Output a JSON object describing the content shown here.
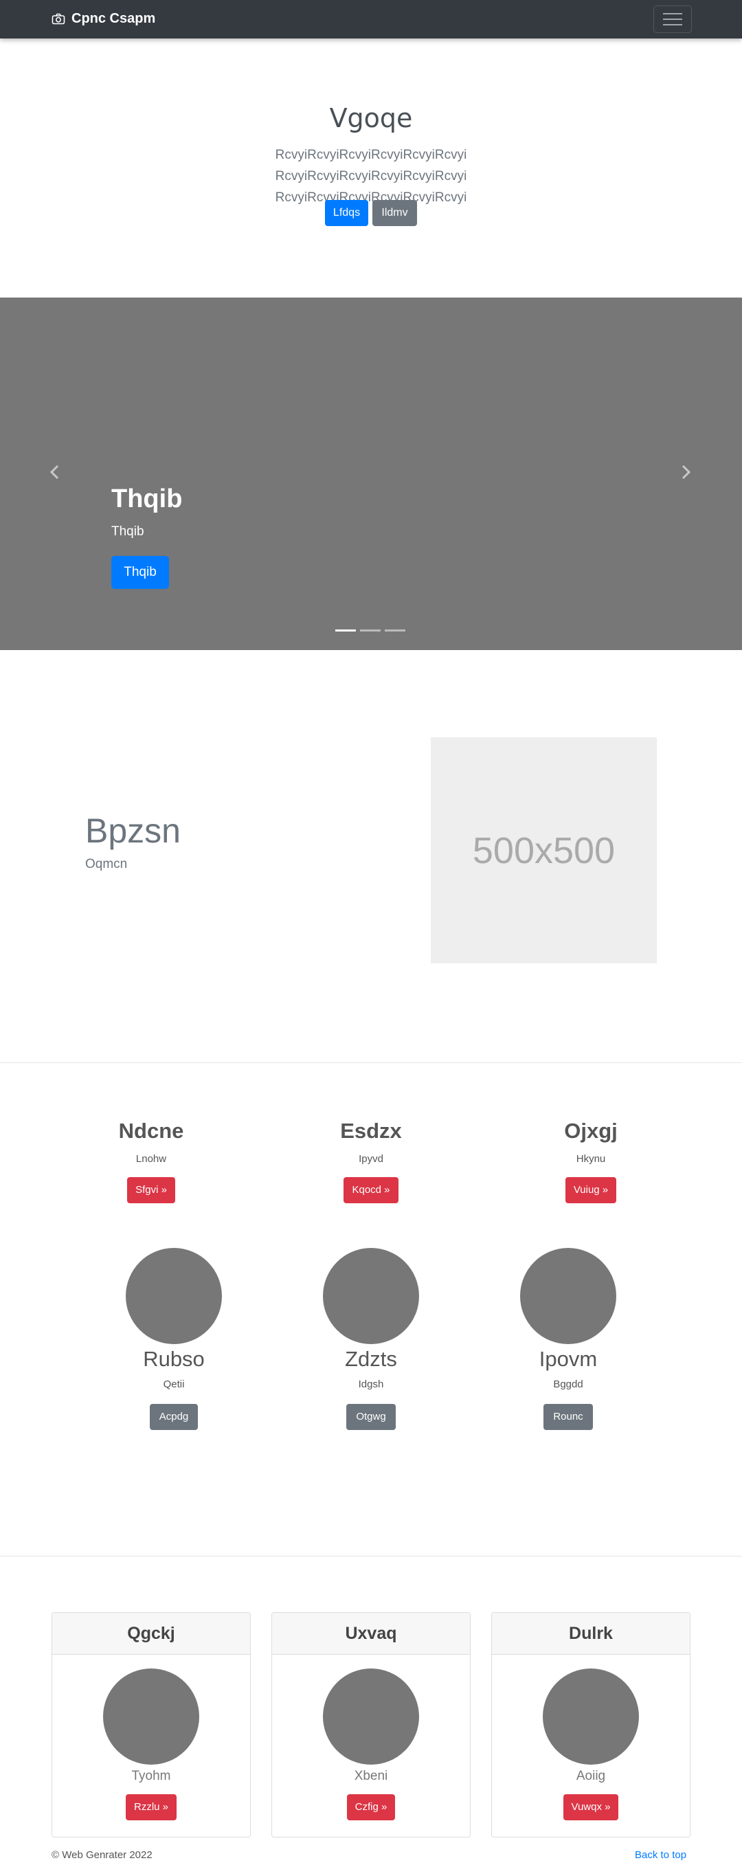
{
  "navbar": {
    "brand": "Cpnc Csapm",
    "brand_icon": "camera-icon",
    "toggler_icon": "hamburger-icon"
  },
  "jumbotron": {
    "title": "Vgoqe",
    "lead": "RcvyiRcvyiRcvyiRcvyiRcvyiRcvyi RcvyiRcvyiRcvyiRcvyiRcvyiRcvyi RcvyiRcvyiRcvyiRcvyiRcvyiRcvyi",
    "primary_btn": "Lfdqs",
    "secondary_btn": "Ildmv"
  },
  "carousel": {
    "title": "Thqib",
    "caption": "Thqib",
    "button": "Thqib",
    "slides": 3,
    "active_slide": 1,
    "bg_color": "#777777"
  },
  "feature": {
    "title": "Bpzsn",
    "subtitle": "Oqmcn",
    "placeholder": "500x500"
  },
  "columns": [
    {
      "title": "Ndcne",
      "text": "Lnohw",
      "button": "Sfgvi »"
    },
    {
      "title": "Esdzx",
      "text": "Ipyvd",
      "button": "Kqocd »"
    },
    {
      "title": "Ojxgj",
      "text": "Hkynu",
      "button": "Vuiug »"
    }
  ],
  "circles": [
    {
      "title": "Rubso",
      "text": "Qetii",
      "button": "Acpdg"
    },
    {
      "title": "Zdzts",
      "text": "Idgsh",
      "button": "Otgwg"
    },
    {
      "title": "Ipovm",
      "text": "Bggdd",
      "button": "Rounc"
    }
  ],
  "cards": [
    {
      "header": "Qgckj",
      "text": "Tyohm",
      "button": "Rzzlu »"
    },
    {
      "header": "Uxvaq",
      "text": "Xbeni",
      "button": "Czfig »"
    },
    {
      "header": "Dulrk",
      "text": "Aoiig",
      "button": "Vuwqx »"
    }
  ],
  "footer": {
    "copyright": "© Web Genrater 2022",
    "back_to_top": "Back to top"
  },
  "colors": {
    "primary": "#007bff",
    "secondary": "#6c757d",
    "danger": "#dc3545",
    "navbar": "#343a40"
  }
}
